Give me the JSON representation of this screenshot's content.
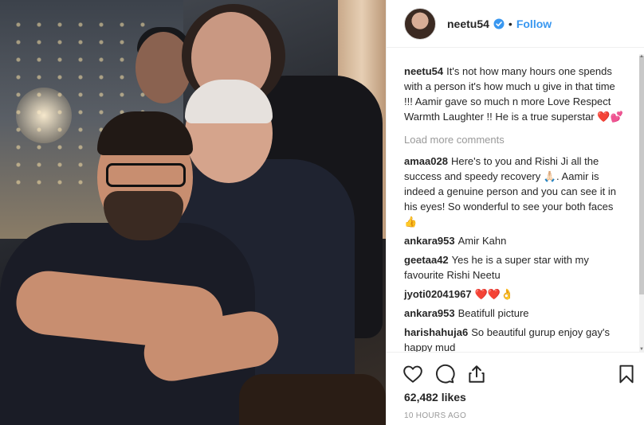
{
  "post": {
    "username": "neetu54",
    "follow_label": "Follow",
    "separator": "•",
    "caption": {
      "user": "neetu54",
      "text": "It's not how many hours one spends with a person it's how much u give in that time !!! Aamir gave so much n more Love Respect Warmth Laughter !! He is a true superstar ❤️💕"
    },
    "load_more": "Load more comments",
    "comments": [
      {
        "user": "amaa028",
        "text": "Here's to you and Rishi Ji all the success and speedy recovery 🙏🏻. Aamir is indeed a genuine person and you can see it in his eyes! So wonderful to see your both faces👍"
      },
      {
        "user": "ankara953",
        "text": "Amir Kahn"
      },
      {
        "user": "geetaa42",
        "text": "Yes he is a super star with my favourite Rishi Neetu"
      },
      {
        "user": "jyoti02041967",
        "text": "❤️❤️👌"
      },
      {
        "user": "ankara953",
        "text": "Beatifull picture"
      },
      {
        "user": "harishahuja6",
        "text": "So beautiful gurup enjoy gay's happy mud"
      }
    ],
    "likes": "62,482 likes",
    "timestamp": "10 HOURS AGO"
  },
  "icons": {
    "verified": "verified-badge-icon",
    "like": "heart-icon",
    "comment": "comment-bubble-icon",
    "share": "share-icon",
    "save": "bookmark-icon"
  },
  "colors": {
    "follow": "#3897f0",
    "muted": "#999999",
    "text": "#262626"
  }
}
